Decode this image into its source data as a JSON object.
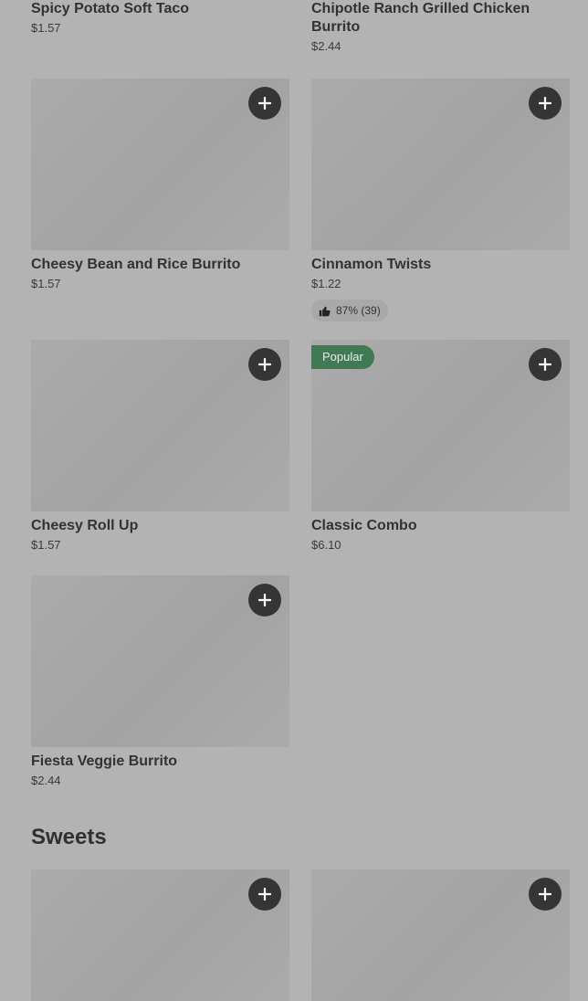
{
  "top_items": [
    {
      "name": "Spicy Potato Soft Taco",
      "price": "$1.57"
    },
    {
      "name": "Chipotle Ranch Grilled Chicken Burrito",
      "price": "$2.44"
    }
  ],
  "items": [
    {
      "name": "Cheesy Bean and Rice Burrito",
      "price": "$1.57"
    },
    {
      "name": "Cinnamon Twists",
      "price": "$1.22",
      "rating": "87% (39)"
    },
    {
      "name": "Cheesy Roll Up",
      "price": "$1.57"
    },
    {
      "name": "Classic Combo",
      "price": "$6.10",
      "badge": "Popular"
    },
    {
      "name": "Fiesta Veggie Burrito",
      "price": "$2.44"
    }
  ],
  "sections": {
    "sweets": "Sweets"
  },
  "icons": {
    "add": "plus-icon",
    "rating": "thumbs-up-icon"
  },
  "colors": {
    "popular_badge": "#3f7a53",
    "add_button": "#353535"
  }
}
